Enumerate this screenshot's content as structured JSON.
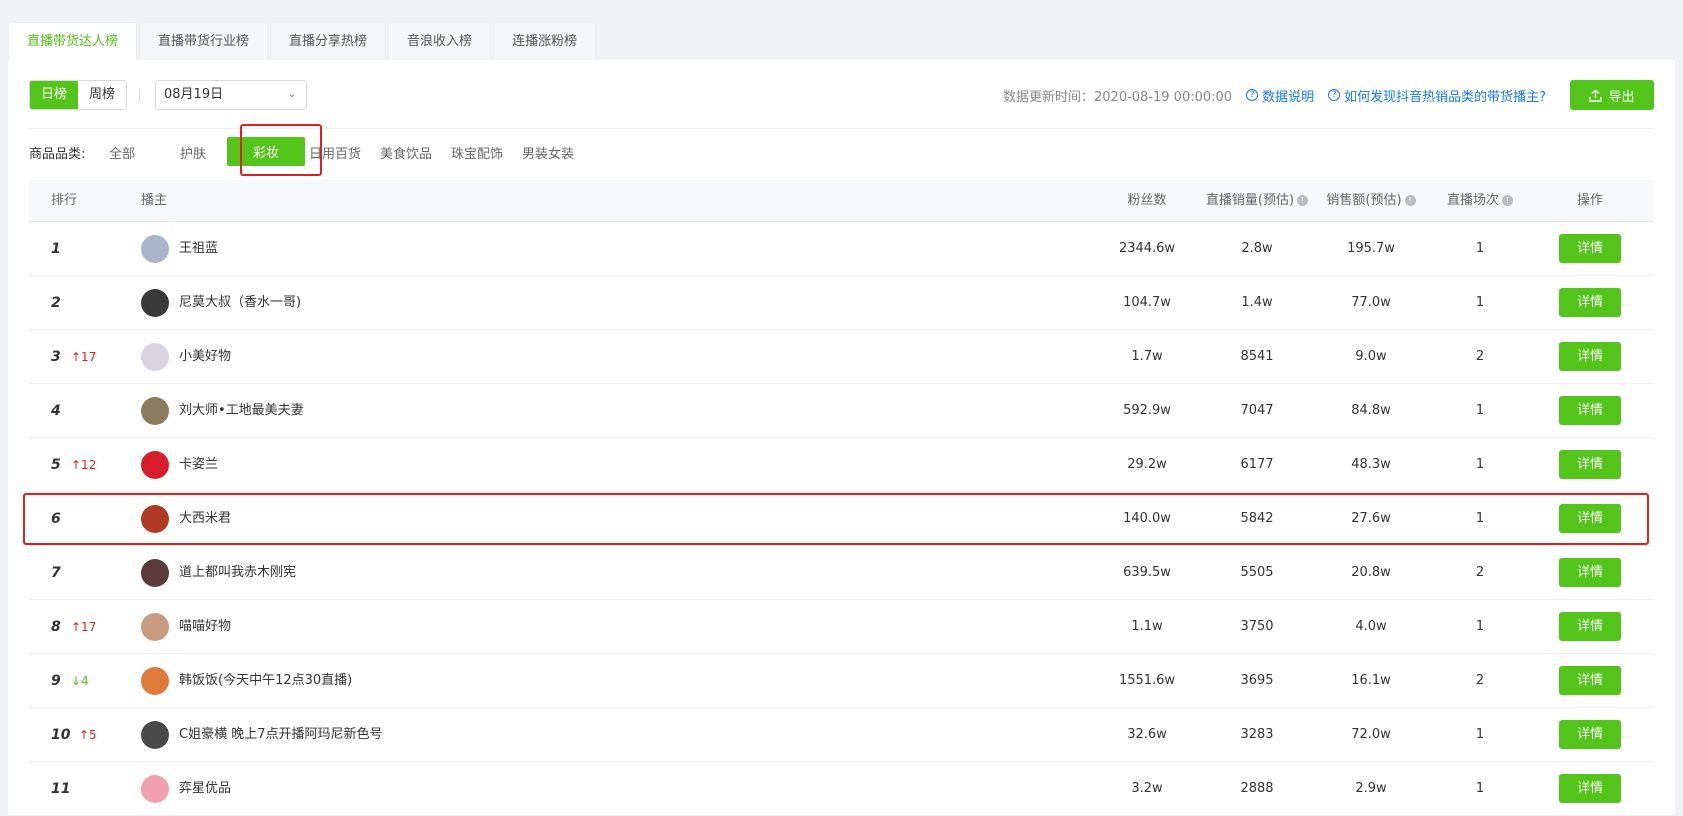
{
  "tabs": [
    "直播带货达人榜",
    "直播带货行业榜",
    "直播分享热榜",
    "音浪收入榜",
    "连播涨粉榜"
  ],
  "toolbar": {
    "day_label": "日榜",
    "week_label": "周榜",
    "date_value": "08月19日",
    "update_time": "数据更新时间：2020-08-19 00:00:00",
    "data_desc": "数据说明",
    "howto": "如何发现抖音热销品类的带货播主?",
    "export_label": "导出"
  },
  "categories": {
    "label": "商品品类:",
    "items": [
      "全部",
      "护肤",
      "彩妆",
      "日用百货",
      "美食饮品",
      "珠宝配饰",
      "男装女装"
    ],
    "selected": "彩妆"
  },
  "table": {
    "headers": {
      "rank": "排行",
      "anchor": "播主",
      "fans": "粉丝数",
      "sales": "直播销量(预估)",
      "amount": "销售额(预估)",
      "sessions": "直播场次",
      "action": "操作"
    },
    "detail_label": "详情",
    "rows": [
      {
        "rank": "1",
        "change": "",
        "name": "王祖蓝",
        "fans": "2344.6w",
        "sales": "2.8w",
        "amount": "195.7w",
        "sessions": "1",
        "avatar_color": "#a7b4c9"
      },
      {
        "rank": "2",
        "change": "",
        "name": "尼莫大叔（香水一哥)",
        "fans": "104.7w",
        "sales": "1.4w",
        "amount": "77.0w",
        "sessions": "1",
        "avatar_color": "#3a3a3a"
      },
      {
        "rank": "3",
        "change": "↑17",
        "name": "小美好物",
        "fans": "1.7w",
        "sales": "8541",
        "amount": "9.0w",
        "sessions": "2",
        "avatar_color": "#d8d4e0"
      },
      {
        "rank": "4",
        "change": "",
        "name": "刘大师•工地最美夫妻",
        "fans": "592.9w",
        "sales": "7047",
        "amount": "84.8w",
        "sessions": "1",
        "avatar_color": "#8a7a60"
      },
      {
        "rank": "5",
        "change": "↑12",
        "name": "卡姿兰",
        "fans": "29.2w",
        "sales": "6177",
        "amount": "48.3w",
        "sessions": "1",
        "avatar_color": "#d81e2c"
      },
      {
        "rank": "6",
        "change": "",
        "name": "大西米君",
        "fans": "140.0w",
        "sales": "5842",
        "amount": "27.6w",
        "sessions": "1",
        "avatar_color": "#b03a22"
      },
      {
        "rank": "7",
        "change": "",
        "name": "道上都叫我赤木刚宪",
        "fans": "639.5w",
        "sales": "5505",
        "amount": "20.8w",
        "sessions": "2",
        "avatar_color": "#5a3a3a"
      },
      {
        "rank": "8",
        "change": "↑17",
        "name": "喵喵好物",
        "fans": "1.1w",
        "sales": "3750",
        "amount": "4.0w",
        "sessions": "1",
        "avatar_color": "#c89c80"
      },
      {
        "rank": "9",
        "change": "↓4",
        "name": "韩饭饭(今天中午12点30直播)",
        "fans": "1551.6w",
        "sales": "3695",
        "amount": "16.1w",
        "sessions": "2",
        "avatar_color": "#e07a3a"
      },
      {
        "rank": "10",
        "change": "↑5",
        "name": "C姐豪横 晚上7点开播阿玛尼新色号",
        "fans": "32.6w",
        "sales": "3283",
        "amount": "72.0w",
        "sessions": "1",
        "avatar_color": "#4a4a4a"
      },
      {
        "rank": "11",
        "change": "",
        "name": "弈星优品",
        "fans": "3.2w",
        "sales": "2888",
        "amount": "2.9w",
        "sessions": "1",
        "avatar_color": "#f0a0b0"
      }
    ]
  },
  "colors": {
    "accent": "#52c41a",
    "highlight": "#e02020",
    "link": "#1677ff"
  }
}
